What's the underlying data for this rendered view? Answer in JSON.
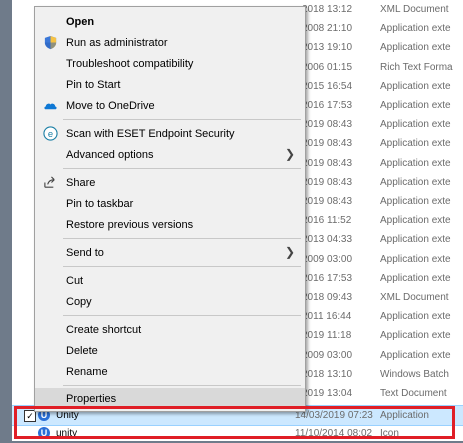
{
  "files": [
    {
      "date": "2018 13:12",
      "type": "XML Document"
    },
    {
      "date": "2008 21:10",
      "type": "Application exte"
    },
    {
      "date": "2013 19:10",
      "type": "Application exte"
    },
    {
      "date": "2006 01:15",
      "type": "Rich Text Forma"
    },
    {
      "date": "2015 16:54",
      "type": "Application exte"
    },
    {
      "date": "2016 17:53",
      "type": "Application exte"
    },
    {
      "date": "2019 08:43",
      "type": "Application exte"
    },
    {
      "date": "2019 08:43",
      "type": "Application exte"
    },
    {
      "date": "2019 08:43",
      "type": "Application exte"
    },
    {
      "date": "2019 08:43",
      "type": "Application exte"
    },
    {
      "date": "2019 08:43",
      "type": "Application exte"
    },
    {
      "date": "2016 11:52",
      "type": "Application exte"
    },
    {
      "date": "2013 04:33",
      "type": "Application exte"
    },
    {
      "date": "2009 03:00",
      "type": "Application exte"
    },
    {
      "date": "2016 17:53",
      "type": "Application exte"
    },
    {
      "date": "2018 09:43",
      "type": "XML Document"
    },
    {
      "date": "2011 16:44",
      "type": "Application exte"
    },
    {
      "date": "2019 11:18",
      "type": "Application exte"
    },
    {
      "date": "2009 03:00",
      "type": "Application exte"
    },
    {
      "date": "2018 13:10",
      "type": "Windows Batch"
    },
    {
      "date": "2019 13:04",
      "type": "Text Document"
    }
  ],
  "selected_file": {
    "name": "Unity",
    "date": "14/03/2019 07:23",
    "type": "Application"
  },
  "next_file": {
    "name": "unity",
    "date": "11/10/2014 08:02",
    "type": "Icon"
  },
  "menu": {
    "open": "Open",
    "run_admin": "Run as administrator",
    "troubleshoot": "Troubleshoot compatibility",
    "pin_start": "Pin to Start",
    "move_onedrive": "Move to OneDrive",
    "scan_eset": "Scan with ESET Endpoint Security",
    "advanced": "Advanced options",
    "share": "Share",
    "pin_taskbar": "Pin to taskbar",
    "restore": "Restore previous versions",
    "send_to": "Send to",
    "cut": "Cut",
    "copy": "Copy",
    "create_shortcut": "Create shortcut",
    "delete": "Delete",
    "rename": "Rename",
    "properties": "Properties"
  },
  "colors": {
    "highlight": "#e01e26",
    "selection": "#cce8ff"
  }
}
